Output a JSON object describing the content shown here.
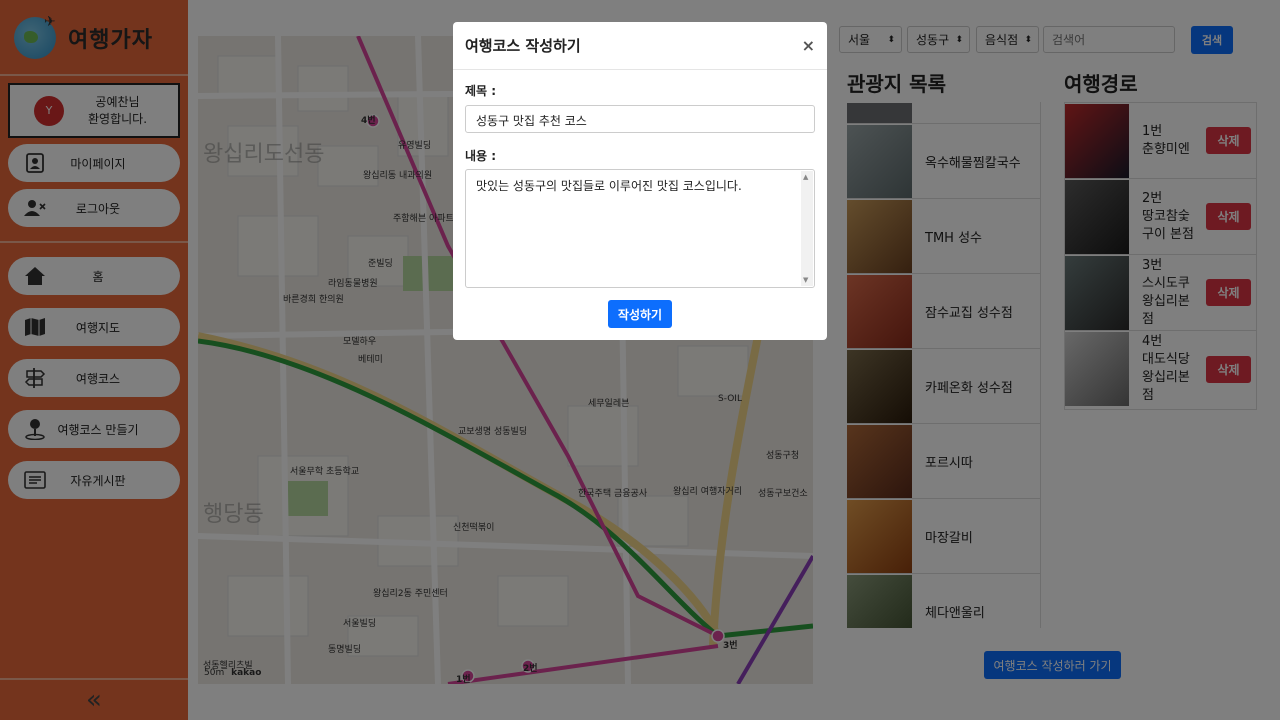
{
  "app": {
    "logo_text": "여행가자",
    "colors": {
      "sidebar": "#e8683b",
      "primary": "#0d6efd",
      "danger": "#dc3545"
    }
  },
  "sidebar": {
    "user": {
      "avatar_initial": "Y",
      "greeting_line1": "공예찬님",
      "greeting_line2": "환영합니다."
    },
    "account_items": [
      {
        "label": "마이페이지",
        "icon": "id-card-icon"
      },
      {
        "label": "로그아웃",
        "icon": "user-remove-icon"
      }
    ],
    "nav_items": [
      {
        "label": "홈",
        "icon": "home-icon"
      },
      {
        "label": "여행지도",
        "icon": "map-icon"
      },
      {
        "label": "여행코스",
        "icon": "signpost-icon"
      },
      {
        "label": "여행코스 만들기",
        "icon": "pin-person-icon"
      },
      {
        "label": "자유게시판",
        "icon": "board-icon"
      }
    ],
    "collapse_icon": "«"
  },
  "map": {
    "big_labels": [
      "왕십리도선동",
      "행당동"
    ],
    "labels": [
      "4번",
      "3번",
      "2번",
      "1번",
      "유영빌딩",
      "왕십리동 내과의원",
      "주함해븐 아파트",
      "준빌딩",
      "라임동물병원",
      "바른경희 한의원",
      "모델하우",
      "베테미",
      "성동구청",
      "S-OIL",
      "성동구보건소",
      "세무일레븐",
      "교보생명 성동빌딩",
      "한국주택 금융공사",
      "왕십리 여행자거리",
      "서울무학 초등학교",
      "신천떡볶이",
      "왕십리2동 주민센터",
      "서울빌딩",
      "동명빌딩",
      "성동헬리츠빌",
      "kakao"
    ],
    "scale": "50m"
  },
  "filters": {
    "city": "서울",
    "district": "성동구",
    "category": "음식점",
    "search_placeholder": "검색어",
    "search_button": "검색"
  },
  "spots": {
    "title": "관광지 목록",
    "items": [
      {
        "name": "",
        "color": "#6d6f72"
      },
      {
        "name": "옥수해물찜칼국수",
        "color": "#7d8a8c"
      },
      {
        "name": "TMH 성수",
        "color": "#9a6a3a"
      },
      {
        "name": "잠수교집 성수점",
        "color": "#b9472a"
      },
      {
        "name": "카페온화 성수점",
        "color": "#4a3a2a"
      },
      {
        "name": "포르시따",
        "color": "#8a4a2a"
      },
      {
        "name": "마장갈비",
        "color": "#c06a2a"
      },
      {
        "name": "체다앤울리",
        "color": "#5a6a4a"
      }
    ]
  },
  "route": {
    "title": "여행경로",
    "delete_label": "삭제",
    "items": [
      {
        "number": "1번",
        "name": "춘향미엔",
        "color": "#2a2a3a"
      },
      {
        "number": "2번",
        "name": "땅코참숯구이 본점",
        "color": "#3a3a3a"
      },
      {
        "number": "3번",
        "name": "스시도쿠 왕십리본점",
        "color": "#3a4a4a"
      },
      {
        "number": "4번",
        "name": "대도식당 왕십리본점",
        "color": "#8a8a8a"
      }
    ],
    "go_button": "여행코스 작성하러 가기"
  },
  "modal": {
    "title": "여행코스 작성하기",
    "close": "×",
    "title_label": "제목 :",
    "title_value": "성동구 맛집 추천 코스",
    "content_label": "내용 :",
    "content_value": "맛있는 성동구의 맛집들로 이루어진 맛집 코스입니다.",
    "submit": "작성하기"
  }
}
